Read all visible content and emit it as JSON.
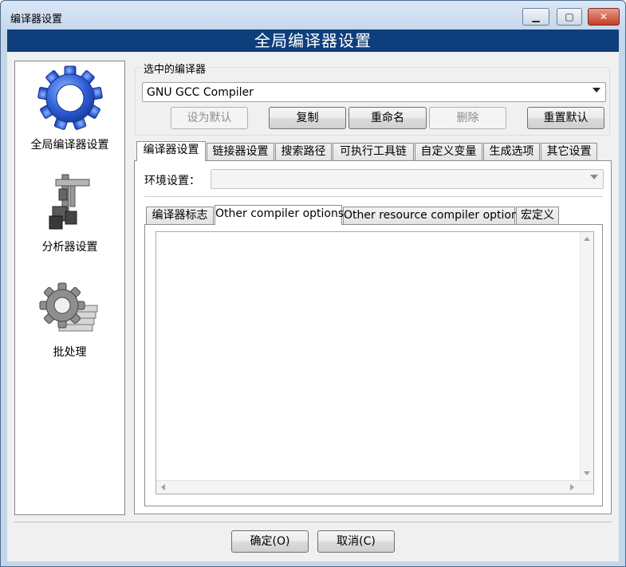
{
  "window": {
    "title": "编译器设置",
    "controls": {
      "minimize": "▁",
      "maximize": "▢",
      "close": "✕"
    }
  },
  "banner": {
    "title": "全局编译器设置"
  },
  "sidebar": {
    "items": [
      {
        "label": "全局编译器设置",
        "icon": "gear-icon"
      },
      {
        "label": "分析器设置",
        "icon": "caliper-icon"
      },
      {
        "label": "批处理",
        "icon": "batch-gear-icon"
      }
    ]
  },
  "compiler": {
    "group_title": "选中的编译器",
    "selected": "GNU GCC Compiler",
    "buttons": {
      "set_default": "设为默认",
      "copy": "复制",
      "rename": "重命名",
      "delete": "删除",
      "reset_defaults": "重置默认"
    }
  },
  "tabs": [
    {
      "label": "编译器设置",
      "active": true
    },
    {
      "label": "链接器设置",
      "active": false
    },
    {
      "label": "搜索路径",
      "active": false
    },
    {
      "label": "可执行工具链",
      "active": false
    },
    {
      "label": "自定义变量",
      "active": false
    },
    {
      "label": "生成选项",
      "active": false
    },
    {
      "label": "其它设置",
      "active": false
    }
  ],
  "environment": {
    "label": "环境设置：",
    "value": ""
  },
  "subtabs": [
    {
      "label": "编译器标志",
      "active": false
    },
    {
      "label": "Other compiler options",
      "active": true
    },
    {
      "label": "Other resource compiler options",
      "active": false
    },
    {
      "label": "宏定义",
      "active": false
    }
  ],
  "editor": {
    "content": ""
  },
  "footer": {
    "ok": "确定(O)",
    "cancel": "取消(C)"
  }
}
